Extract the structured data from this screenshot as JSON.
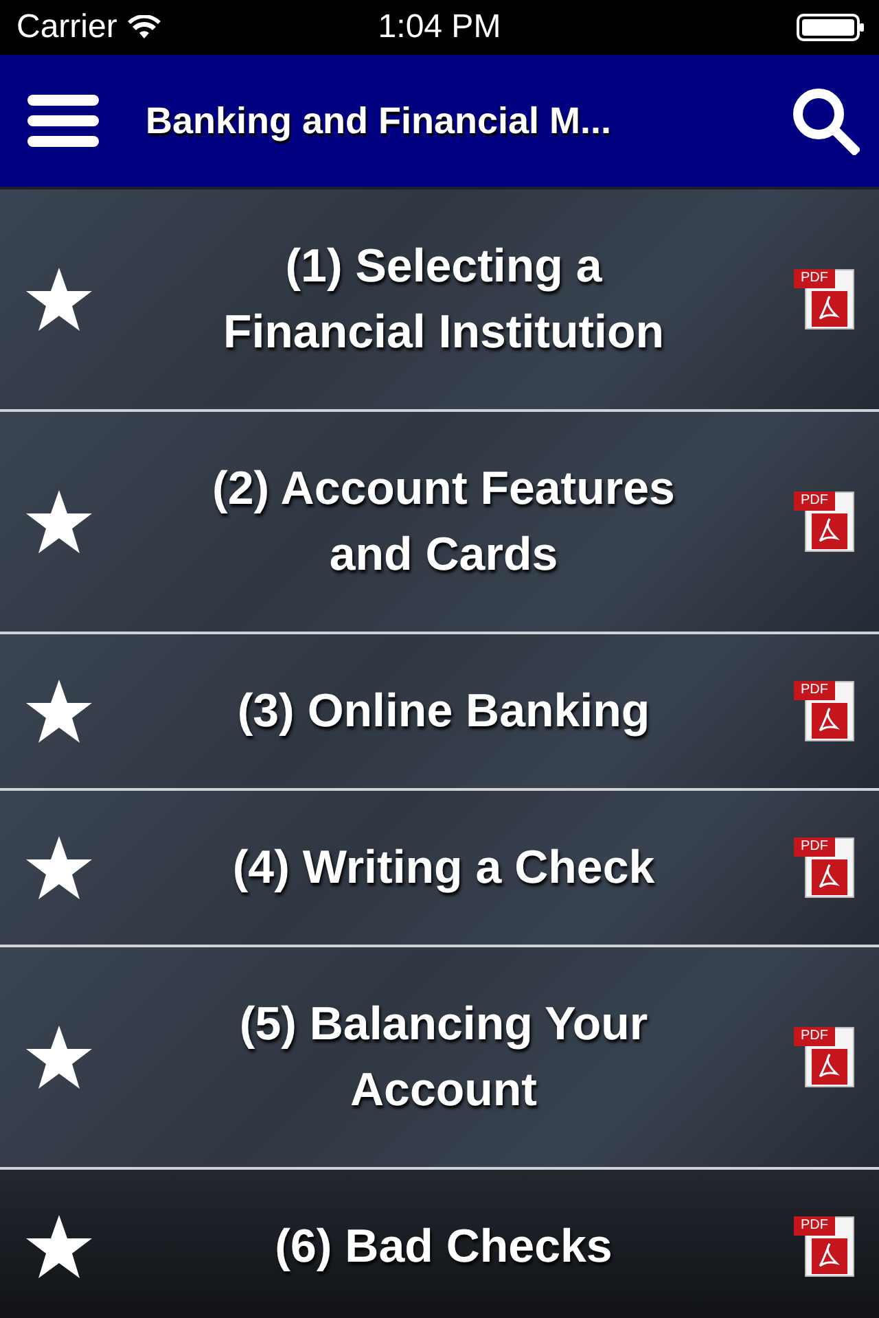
{
  "status_bar": {
    "carrier": "Carrier",
    "time": "1:04 PM"
  },
  "header": {
    "title": "Banking and Financial M..."
  },
  "chapters": [
    {
      "title": "(1) Selecting a\nFinancial Institution",
      "badge": "PDF"
    },
    {
      "title": "(2) Account Features\nand Cards",
      "badge": "PDF"
    },
    {
      "title": "(3) Online Banking",
      "badge": "PDF"
    },
    {
      "title": "(4) Writing a Check",
      "badge": "PDF"
    },
    {
      "title": "(5) Balancing Your\nAccount",
      "badge": "PDF"
    },
    {
      "title": "(6) Bad Checks",
      "badge": "PDF"
    }
  ]
}
